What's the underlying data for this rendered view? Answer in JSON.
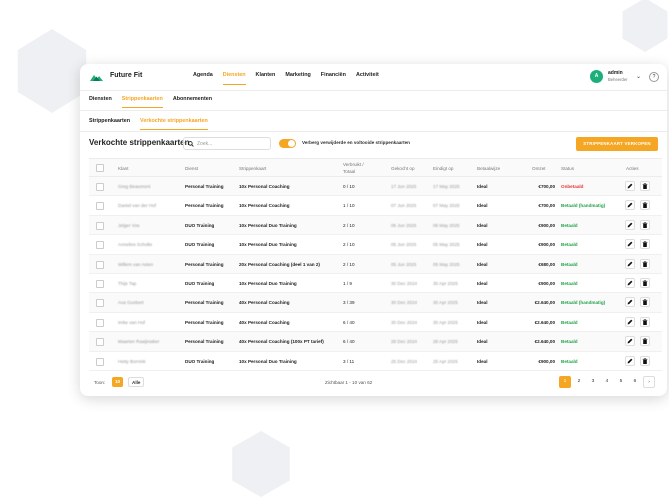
{
  "app": {
    "brand": "Future Fit"
  },
  "nav": [
    "Agenda",
    "Diensten",
    "Klanten",
    "Marketing",
    "Financiën",
    "Activiteit"
  ],
  "nav_active": 1,
  "user": {
    "initial": "A",
    "name": "admin",
    "role": "Beheerder",
    "help": "?"
  },
  "subtabs": [
    "Diensten",
    "Strippenkaarten",
    "Abonnementen"
  ],
  "subtabs_active": 1,
  "subtabs2": [
    "Strippenkaarten",
    "Verkochte strippenkaarten"
  ],
  "subtabs2_active": 1,
  "page": {
    "title": "Verkochte strippenkaarten",
    "search_placeholder": "Zoek...",
    "toggle_label": "Verberg verwijderde en voltooide strippenkaarten",
    "sell_button": "STRIPPENKAART VERKOPEN"
  },
  "columns": {
    "klant": "Klant",
    "dienst": "Dienst",
    "strip": "Strippenkaart",
    "verbruikt1": "Verbruikt /",
    "verbruikt2": "Totaal",
    "gekocht": "Gekocht op",
    "eindigt": "Eindigt op",
    "betaal": "Betaalwijze",
    "omzet": "Omzet",
    "status": "Status",
    "acties": "Acties"
  },
  "rows": [
    {
      "klant": "Greg Beaumont",
      "dienst": "Personal Training",
      "strip": "10x Personal Coaching",
      "verbruikt": "0 / 10",
      "gekocht": "17 Jun 2025",
      "eindigt": "17 May 2025",
      "betaal": "Ideal",
      "omzet": "€700,00",
      "status": "Onbetaald",
      "status_color": "#e53935"
    },
    {
      "klant": "Daniel van der Hof",
      "dienst": "Personal Training",
      "strip": "10x Personal Coaching",
      "verbruikt": "1 / 10",
      "gekocht": "07 Jun 2025",
      "eindigt": "07 May 2025",
      "betaal": "Ideal",
      "omzet": "€700,00",
      "status": "Betaald (handmatig)",
      "status_color": "#22a34a"
    },
    {
      "klant": "Jelger Vos",
      "dienst": "DUO Training",
      "strip": "10x Personal Duo Training",
      "verbruikt": "2 / 10",
      "gekocht": "06 Jun 2025",
      "eindigt": "06 May 2025",
      "betaal": "Ideal",
      "omzet": "€900,00",
      "status": "Betaald",
      "status_color": "#22a34a"
    },
    {
      "klant": "Annelies Scholte",
      "dienst": "DUO Training",
      "strip": "10x Personal Duo Training",
      "verbruikt": "2 / 10",
      "gekocht": "05 Jun 2025",
      "eindigt": "05 May 2025",
      "betaal": "Ideal",
      "omzet": "€900,00",
      "status": "Betaald",
      "status_color": "#22a34a"
    },
    {
      "klant": "Willem van Asten",
      "dienst": "Personal Training",
      "strip": "20x Personal Coaching (deel 1 van 2)",
      "verbruikt": "2 / 10",
      "gekocht": "05 Jun 2025",
      "eindigt": "05 May 2025",
      "betaal": "Ideal",
      "omzet": "€680,00",
      "status": "Betaald",
      "status_color": "#22a34a"
    },
    {
      "klant": "Thijs Tap",
      "dienst": "DUO Training",
      "strip": "10x Personal Duo Training",
      "verbruikt": "1 / 9",
      "gekocht": "30 Dec 2024",
      "eindigt": "30 Apr 2025",
      "betaal": "Ideal",
      "omzet": "€900,00",
      "status": "Betaald",
      "status_color": "#22a34a"
    },
    {
      "klant": "Ava Gunbert",
      "dienst": "Personal Training",
      "strip": "40x Personal Coaching",
      "verbruikt": "3 / 39",
      "gekocht": "30 Dec 2024",
      "eindigt": "30 Apr 2025",
      "betaal": "Ideal",
      "omzet": "€2.640,00",
      "status": "Betaald (handmatig)",
      "status_color": "#22a34a"
    },
    {
      "klant": "Imke van Hof",
      "dienst": "Personal Training",
      "strip": "40x Personal Coaching",
      "verbruikt": "6 / 40",
      "gekocht": "30 Dec 2024",
      "eindigt": "30 Apr 2025",
      "betaal": "Ideal",
      "omzet": "€2.640,00",
      "status": "Betaald",
      "status_color": "#22a34a"
    },
    {
      "klant": "Maarten Raaijmaker",
      "dienst": "Personal Training",
      "strip": "40x Personal Coaching (100x PT tarief)",
      "verbruikt": "6 / 40",
      "gekocht": "28 Dec 2024",
      "eindigt": "28 Apr 2025",
      "betaal": "Ideal",
      "omzet": "€2.640,00",
      "status": "Betaald",
      "status_color": "#22a34a"
    },
    {
      "klant": "Hetty Bornink",
      "dienst": "DUO Training",
      "strip": "10x Personal Duo Training",
      "verbruikt": "3 / 11",
      "gekocht": "25 Dec 2024",
      "eindigt": "25 Apr 2025",
      "betaal": "Ideal",
      "omzet": "€900,00",
      "status": "Betaald",
      "status_color": "#22a34a"
    }
  ],
  "footer": {
    "per_page_label": "Toon:",
    "per_page_options": [
      "10",
      "Alle"
    ],
    "per_page_active": 0,
    "range_text": "Zichtbaar 1 - 10 van 62",
    "pages": [
      "1",
      "2",
      "3",
      "4",
      "5",
      "6"
    ],
    "current_page": 0,
    "next": "›"
  },
  "colors": {
    "accent": "#f5a623",
    "brand": "#1bb07a",
    "paid": "#22a34a",
    "unpaid": "#e53935"
  }
}
